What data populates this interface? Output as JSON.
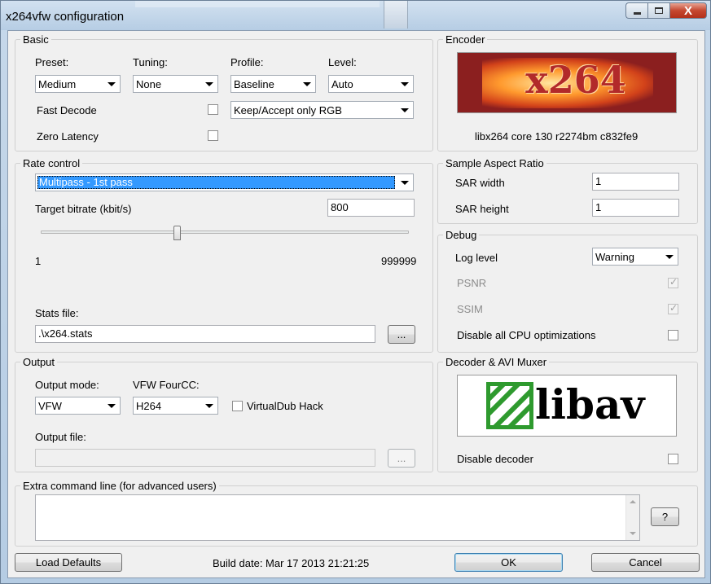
{
  "window": {
    "title": "x264vfw configuration",
    "close_label": "X"
  },
  "basic": {
    "legend": "Basic",
    "preset": {
      "label": "Preset:",
      "value": "Medium"
    },
    "tuning": {
      "label": "Tuning:",
      "value": "None"
    },
    "profile": {
      "label": "Profile:",
      "value": "Baseline"
    },
    "level": {
      "label": "Level:",
      "value": "Auto"
    },
    "fast_decode": {
      "label": "Fast Decode",
      "checked": false
    },
    "zero_latency": {
      "label": "Zero Latency",
      "checked": false
    },
    "colorspace": {
      "value": "Keep/Accept only RGB"
    }
  },
  "encoder": {
    "legend": "Encoder",
    "logo_text": "x264",
    "version": "libx264 core 130 r2274bm c832fe9"
  },
  "rate_control": {
    "legend": "Rate control",
    "mode": "Multipass - 1st pass",
    "bitrate_label": "Target bitrate (kbit/s)",
    "bitrate_value": "800",
    "slider_min": "1",
    "slider_max": "999999",
    "stats_label": "Stats file:",
    "stats_value": ".\\x264.stats",
    "browse_label": "..."
  },
  "sar": {
    "legend": "Sample Aspect Ratio",
    "width_label": "SAR width",
    "width_value": "1",
    "height_label": "SAR height",
    "height_value": "1"
  },
  "debug": {
    "legend": "Debug",
    "log_level_label": "Log level",
    "log_level_value": "Warning",
    "psnr_label": "PSNR",
    "ssim_label": "SSIM",
    "disable_cpu_label": "Disable all CPU optimizations"
  },
  "output": {
    "legend": "Output",
    "mode_label": "Output mode:",
    "mode_value": "VFW",
    "fourcc_label": "VFW FourCC:",
    "fourcc_value": "H264",
    "virtualdub_label": "VirtualDub Hack",
    "file_label": "Output file:",
    "file_value": "",
    "browse_label": "..."
  },
  "decoder": {
    "legend": "Decoder & AVI Muxer",
    "logo_text": "libav",
    "disable_label": "Disable decoder"
  },
  "extra": {
    "legend": "Extra command line (for advanced users)",
    "help_label": "?"
  },
  "footer": {
    "load_defaults": "Load Defaults",
    "build_date": "Build date: Mar 17 2013 21:21:25",
    "ok": "OK",
    "cancel": "Cancel"
  },
  "colors": {
    "selection": "#3399ff",
    "libav_green": "#2e9a2e",
    "x264_red": "#8b1f1f"
  }
}
